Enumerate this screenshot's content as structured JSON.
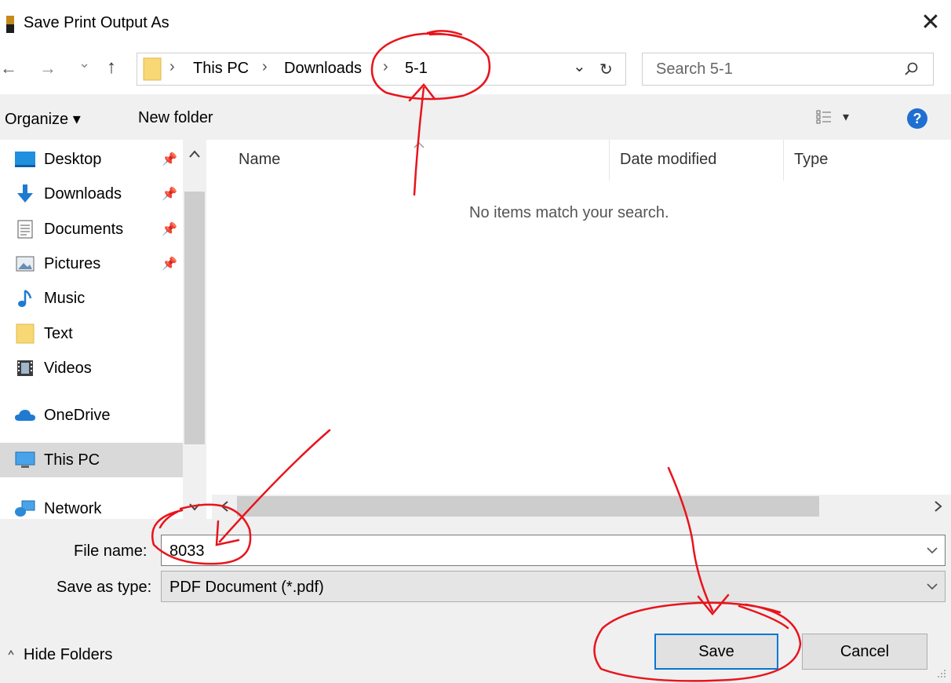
{
  "window": {
    "title": "Save Print Output As",
    "close_glyph": "✕"
  },
  "nav": {
    "back_glyph": "←",
    "forward_glyph": "→",
    "recent_glyph": "⌄",
    "up_glyph": "↑",
    "breadcrumb": [
      "This PC",
      "Downloads",
      "5-1"
    ],
    "sep_glyph": "›",
    "dropdown_glyph": "⌄",
    "refresh_glyph": "↻",
    "search_placeholder": "Search 5-1"
  },
  "toolbar": {
    "organize": "Organize ▾",
    "new_folder": "New folder",
    "view_glyph": "▾",
    "help_glyph": "?"
  },
  "sidebar": {
    "items": [
      {
        "label": "Desktop",
        "icon": "desktop-icon"
      },
      {
        "label": "Downloads",
        "icon": "downloads-icon"
      },
      {
        "label": "Documents",
        "icon": "documents-icon"
      },
      {
        "label": "Pictures",
        "icon": "pictures-icon"
      },
      {
        "label": "Music",
        "icon": "music-icon"
      },
      {
        "label": "Text",
        "icon": "folder-icon"
      },
      {
        "label": "Videos",
        "icon": "videos-icon"
      },
      {
        "label": "OneDrive",
        "icon": "onedrive-icon"
      },
      {
        "label": "This PC",
        "icon": "this-pc-icon"
      },
      {
        "label": "Network",
        "icon": "network-icon"
      }
    ],
    "pin_glyph": "📌"
  },
  "list": {
    "columns": [
      "Name",
      "Date modified",
      "Type"
    ],
    "empty_message": "No items match your search."
  },
  "form": {
    "filename_label": "File name:",
    "filename_value": "8033",
    "type_label": "Save as type:",
    "type_value": "PDF Document (*.pdf)",
    "hide_folders": "Hide Folders",
    "save": "Save",
    "cancel": "Cancel"
  },
  "colors": {
    "accent": "#0078d7",
    "folder": "#f8d775",
    "annotation": "#e8141c"
  }
}
